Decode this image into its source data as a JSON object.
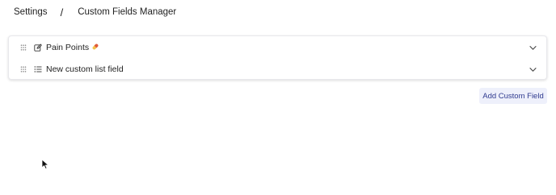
{
  "breadcrumb": {
    "parent": "Settings",
    "separator": "/",
    "current": "Custom Fields Manager"
  },
  "fields": [
    {
      "label": "Pain Points",
      "type_icon": "edit-icon",
      "emoji": "pill"
    },
    {
      "label": "New custom list field",
      "type_icon": "list-icon"
    }
  ],
  "actions": {
    "add_custom_field": "Add Custom Field"
  },
  "colors": {
    "accent_text": "#2f3a8f",
    "button_bg": "#eef0fb"
  }
}
